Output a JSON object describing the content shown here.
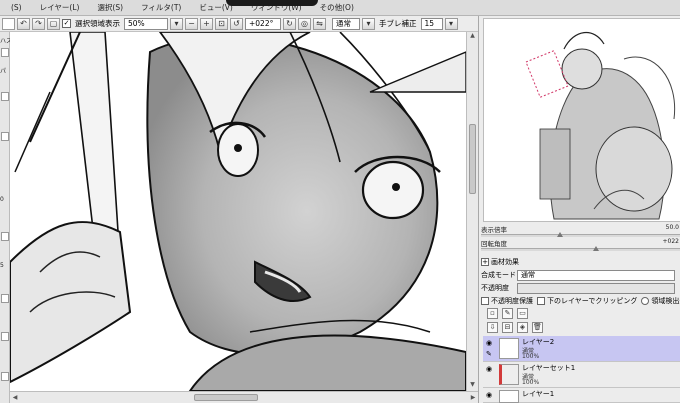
{
  "menu": {
    "items": [
      "(S)",
      "レイヤー(L)",
      "選択(S)",
      "フィルタ(T)",
      "ビュー(V)",
      "ウィンドウ(W)",
      "その他(O)"
    ]
  },
  "toolbar": {
    "selection_checkbox_label": "選択領域表示",
    "zoom_value": "50%",
    "angle_value": "+022°",
    "blend_label": "通常",
    "stabilizer_label": "手ブレ補正",
    "stabilizer_value": "15"
  },
  "left_strip": {
    "label_1": "ハス",
    "label_2": "パ",
    "value_1": "0",
    "value_2": "5"
  },
  "navigator": {
    "zoom_label": "表示倍率",
    "zoom_value": "50.0",
    "rotation_label": "回転角度",
    "rotation_value": "+022"
  },
  "layer_props": {
    "texture_label": "画材効果",
    "blend_mode_label": "合成モード",
    "blend_mode_value": "通常",
    "opacity_label": "不透明度",
    "protect_opacity_label": "不透明度保護",
    "clip_label": "下のレイヤーでクリッピング",
    "selection_source_label": "領域検出元に設定"
  },
  "layers": [
    {
      "name": "レイヤー2",
      "mode": "通常",
      "opacity": "100%",
      "selected": true
    },
    {
      "name": "レイヤーセット1",
      "mode": "通常",
      "opacity": "100%",
      "selected": false
    },
    {
      "name": "レイヤー1",
      "mode": "",
      "opacity": "",
      "selected": false
    }
  ],
  "colors": {
    "selected_layer": "#c7c6f2",
    "canvas_bg": "#ffffff",
    "panel_bg": "#ececec"
  }
}
